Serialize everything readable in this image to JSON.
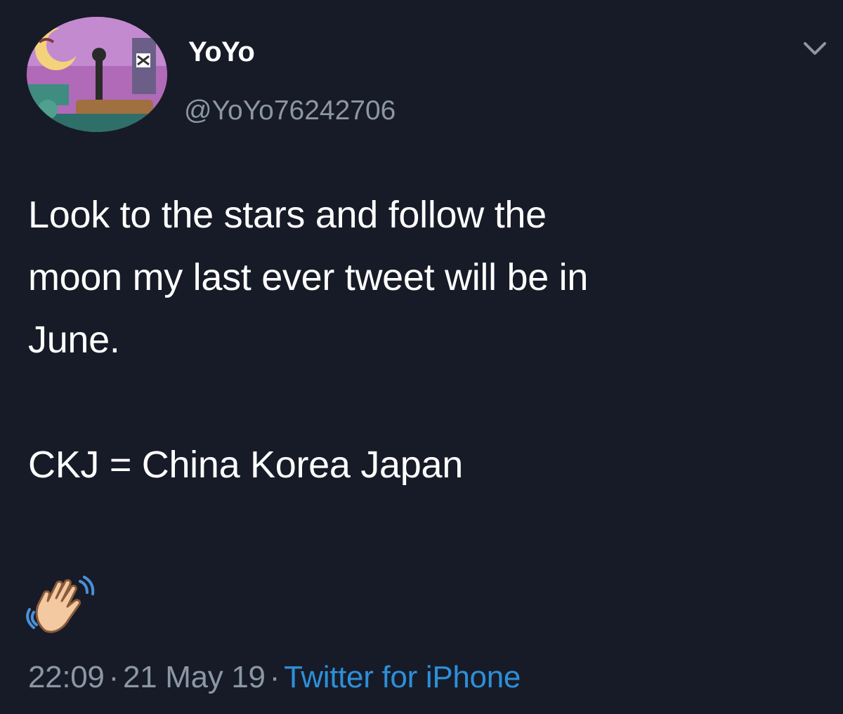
{
  "user": {
    "display_name": "YoYo",
    "handle": "@YoYo76242706"
  },
  "tweet": {
    "text": "Look to the stars and follow the\nmoon my last ever tweet will be in\nJune.\n\nCKJ = China Korea Japan",
    "emoji": "waving-hand",
    "time": "22:09",
    "date": "21 May 19",
    "separator": "·",
    "source": "Twitter for iPhone"
  },
  "colors": {
    "background": "#171b27",
    "text": "#ffffff",
    "muted": "#8b97a4",
    "link": "#2d8fd9"
  },
  "icons": {
    "menu": "chevron-down-icon",
    "reaction": "waving-hand-icon"
  }
}
